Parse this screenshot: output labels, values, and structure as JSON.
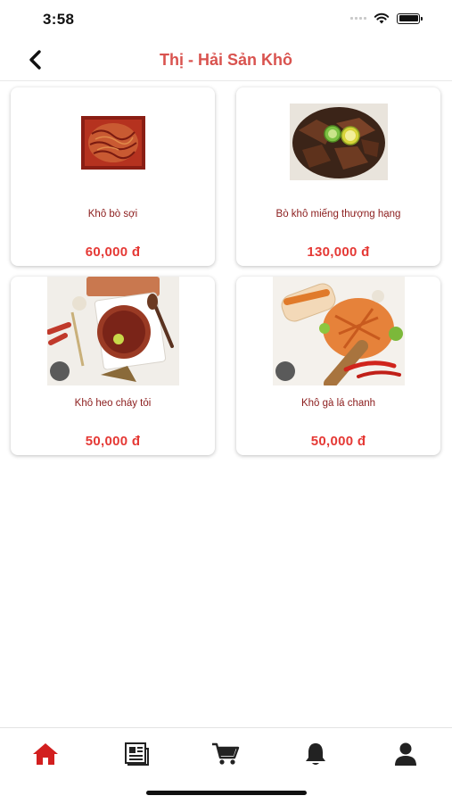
{
  "status_bar": {
    "time": "3:58"
  },
  "header": {
    "title": "Thị - Hải Sản Khô"
  },
  "products": [
    {
      "name": "Khô bò sợi",
      "price": "60,000 đ"
    },
    {
      "name": "Bò khô miếng thượng hạng",
      "price": "130,000 đ"
    },
    {
      "name": "Khô heo cháy tỏi",
      "price": "50,000 đ"
    },
    {
      "name": "Khô gà lá chanh",
      "price": "50,000 đ"
    }
  ],
  "tab_bar": {
    "active": "home",
    "active_color": "#d21f1f",
    "inactive_color": "#222222",
    "icons": [
      "home-icon",
      "news-icon",
      "cart-icon",
      "bell-icon",
      "user-icon"
    ]
  },
  "colors": {
    "title": "#d9534f",
    "price": "#e53935",
    "product_name": "#8b1c1c"
  }
}
